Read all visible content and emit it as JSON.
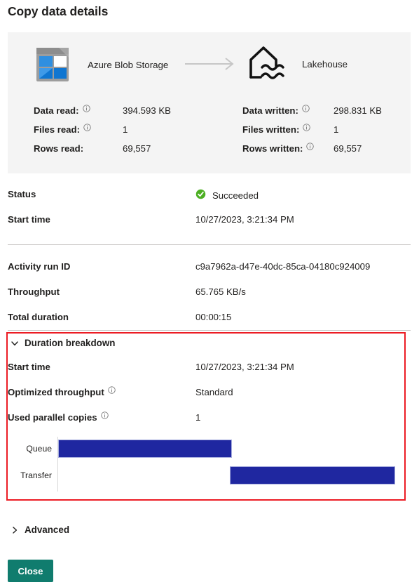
{
  "page_title": "Copy data details",
  "summary": {
    "source": {
      "name": "Azure Blob Storage",
      "icon": "azure-blob-storage-icon"
    },
    "destination": {
      "name": "Lakehouse",
      "icon": "lakehouse-icon"
    },
    "arrow_icon": "arrow-right-icon",
    "left_metrics": [
      {
        "label": "Data read:",
        "value": "394.593 KB",
        "info": true
      },
      {
        "label": "Files read:",
        "value": "1",
        "info": true
      },
      {
        "label": "Rows read:",
        "value": "69,557",
        "info": false
      }
    ],
    "right_metrics": [
      {
        "label": "Data written:",
        "value": "298.831 KB",
        "info": true
      },
      {
        "label": "Files written:",
        "value": "1",
        "info": true
      },
      {
        "label": "Rows written:",
        "value": "69,557",
        "info": true
      }
    ]
  },
  "status_section": {
    "status_label": "Status",
    "status_value": "Succeeded",
    "status_icon": "success-check-icon",
    "start_time_label": "Start time",
    "start_time_value": "10/27/2023, 3:21:34 PM"
  },
  "run_section": {
    "activity_run_id_label": "Activity run ID",
    "activity_run_id_value": "c9a7962a-d47e-40dc-85ca-04180c924009",
    "throughput_label": "Throughput",
    "throughput_value": "65.765 KB/s",
    "total_duration_label": "Total duration",
    "total_duration_value": "00:00:15"
  },
  "duration_breakdown": {
    "header": "Duration breakdown",
    "expanded": true,
    "chevron_icon": "chevron-down-icon",
    "rows": [
      {
        "label": "Start time",
        "value": "10/27/2023, 3:21:34 PM",
        "info": false
      },
      {
        "label": "Optimized throughput",
        "value": "Standard",
        "info": true
      },
      {
        "label": "Used parallel copies",
        "value": "1",
        "info": true
      }
    ]
  },
  "chart_data": {
    "type": "bar",
    "title": "Duration breakdown",
    "orientation": "horizontal-gantt",
    "categories": [
      "Queue",
      "Transfer"
    ],
    "series": [
      {
        "name": "Queue",
        "start_pct": 0.0,
        "end_pct": 51.5,
        "color": "#1f27a0"
      },
      {
        "name": "Transfer",
        "start_pct": 51.0,
        "end_pct": 100.0,
        "color": "#1f27a0"
      }
    ],
    "xlabel": "",
    "ylabel": "",
    "xlim": [
      0,
      100
    ],
    "grid": false,
    "legend": "none"
  },
  "advanced": {
    "header": "Advanced",
    "expanded": false,
    "chevron_icon": "chevron-right-icon"
  },
  "footer": {
    "close_label": "Close"
  },
  "colors": {
    "panel_background": "#f4f4f4",
    "bar_blue": "#1f27a0",
    "highlight_red": "#ec1c24",
    "success_green": "#4caf22",
    "close_teal": "#107c6e",
    "divider_gray": "#c8c6c4"
  }
}
